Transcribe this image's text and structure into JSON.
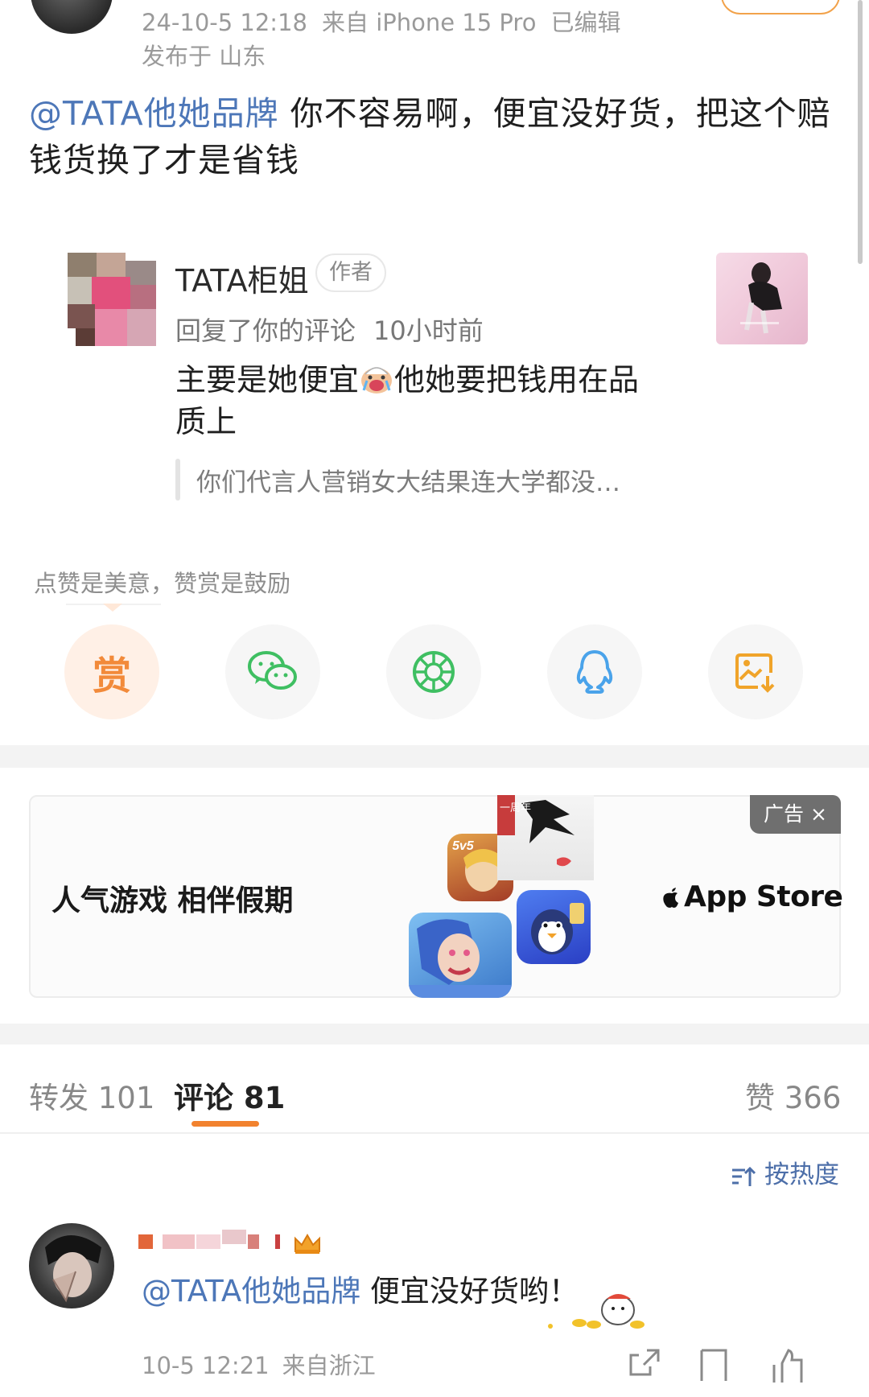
{
  "post": {
    "timestamp": "24-10-5 12:18",
    "device": "来自 iPhone 15 Pro",
    "edited": "已编辑",
    "location": "发布于 山东",
    "mention": "@TATA他她品牌",
    "text": " 你不容易啊，便宜没好货，把这个赔钱货换了才是省钱"
  },
  "reply": {
    "author_name": "TATA柜姐",
    "author_badge": "作者",
    "action": "回复了你的评论",
    "time": "10小时前",
    "body_part1": "主要是她便宜",
    "body_emoji": "crying-emoji",
    "body_part2": "他她要把钱用在品质上",
    "quote": "你们代言人营销女大结果连大学都没…"
  },
  "reward": {
    "hint": "点赞是美意，赞赏是鼓励",
    "reward_label": "赏",
    "share_targets": [
      "wechat-icon",
      "moments-icon",
      "qq-icon",
      "save-image-icon"
    ]
  },
  "ad": {
    "headline": "人气游戏 相伴假期",
    "tag": "广告",
    "close_glyph": "×",
    "store": "App Store",
    "store_logo": "apple-icon",
    "game_badges": [
      "5v5",
      "一周年"
    ]
  },
  "tabs": {
    "repost_label": "转发",
    "repost_count": "101",
    "comment_label": "评论",
    "comment_count": "81",
    "like_label": "赞",
    "like_count": "366"
  },
  "sort": {
    "label": "按热度"
  },
  "comment": {
    "mention": "@TATA他她品牌",
    "text": " 便宜没好货哟！",
    "time": "10-5 12:21",
    "location": "来自浙江"
  },
  "colors": {
    "accent_orange": "#f2822e",
    "link_blue": "#4d77b8",
    "wechat_green": "#3fbf62",
    "qq_blue": "#4aa3ea",
    "save_orange": "#f0a42a"
  }
}
